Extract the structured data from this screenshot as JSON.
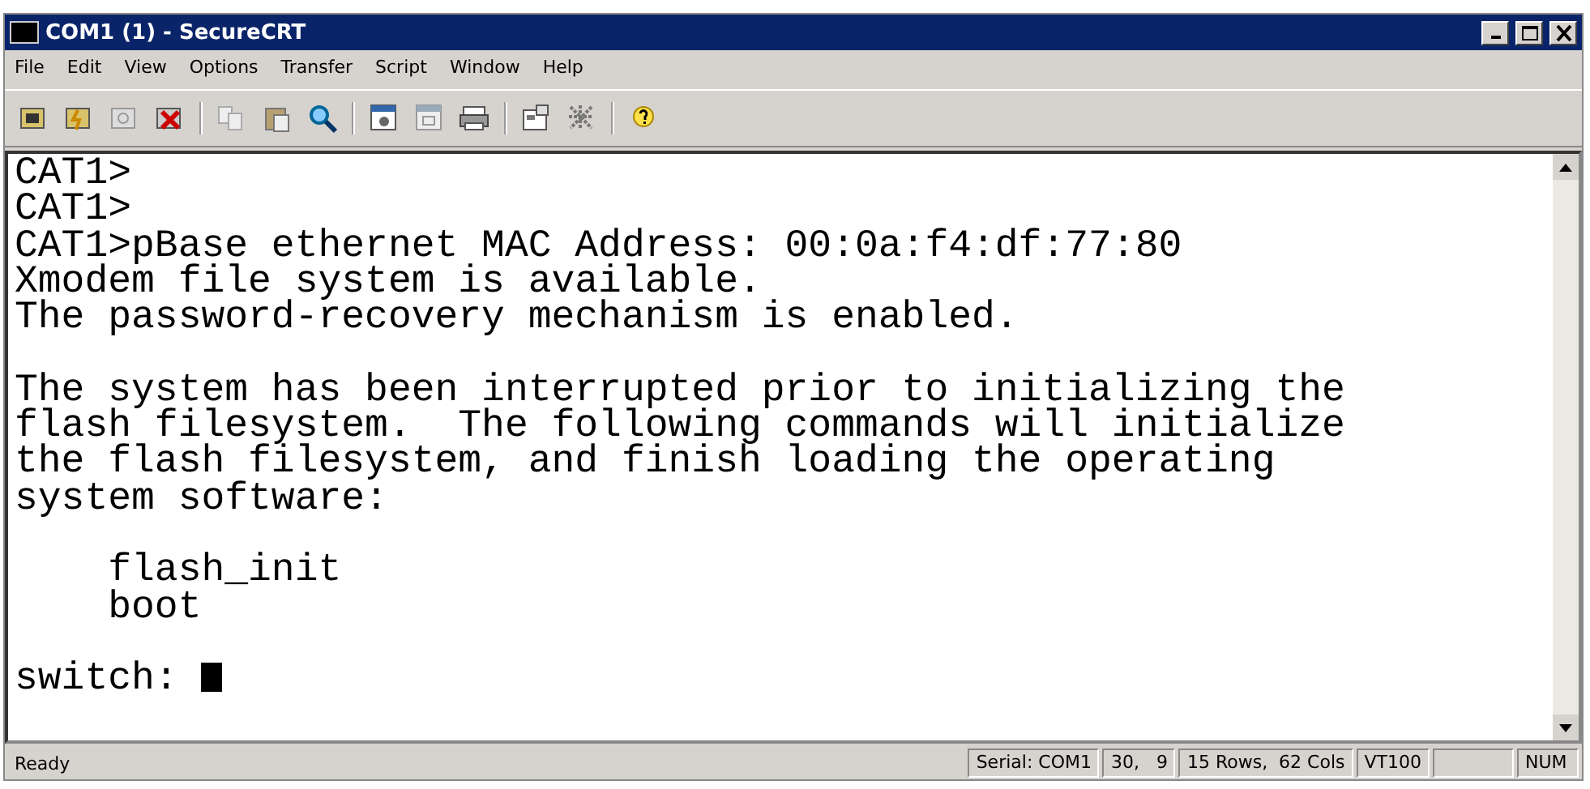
{
  "window": {
    "title": "COM1 (1) - SecureCRT"
  },
  "menu": [
    "File",
    "Edit",
    "View",
    "Options",
    "Transfer",
    "Script",
    "Window",
    "Help"
  ],
  "terminal": {
    "lines": [
      {
        "text": "CAT1>",
        "gap_before": false
      },
      {
        "text": "CAT1>",
        "gap_before": false
      },
      {
        "text": "CAT1>pBase ethernet MAC Address: 00:0a:f4:df:77:80",
        "gap_before": false
      },
      {
        "text": "Xmodem file system is available.",
        "gap_before": false
      },
      {
        "text": "The password-recovery mechanism is enabled.",
        "gap_before": false
      },
      {
        "text": "The system has been interrupted prior to initializing the",
        "gap_before": true
      },
      {
        "text": "flash filesystem.  The following commands will initialize",
        "gap_before": false
      },
      {
        "text": "the flash filesystem, and finish loading the operating",
        "gap_before": false
      },
      {
        "text": "system software:",
        "gap_before": false
      },
      {
        "text": "    flash_init",
        "gap_before": true
      },
      {
        "text": "    boot",
        "gap_before": false
      },
      {
        "text": "switch: ",
        "gap_before": true,
        "cursor": true
      }
    ]
  },
  "status_bar": {
    "message": "Ready",
    "panes": [
      {
        "text": "Serial: COM1",
        "empty_pane_after": false
      },
      {
        "text": "30,   9",
        "empty_pane_after": false
      },
      {
        "text": "15 Rows,  62 Cols",
        "empty_pane_after": false
      },
      {
        "text": "VT100",
        "empty_pane_after": true
      },
      {
        "text": "NUM",
        "empty_pane_after": false
      }
    ]
  }
}
